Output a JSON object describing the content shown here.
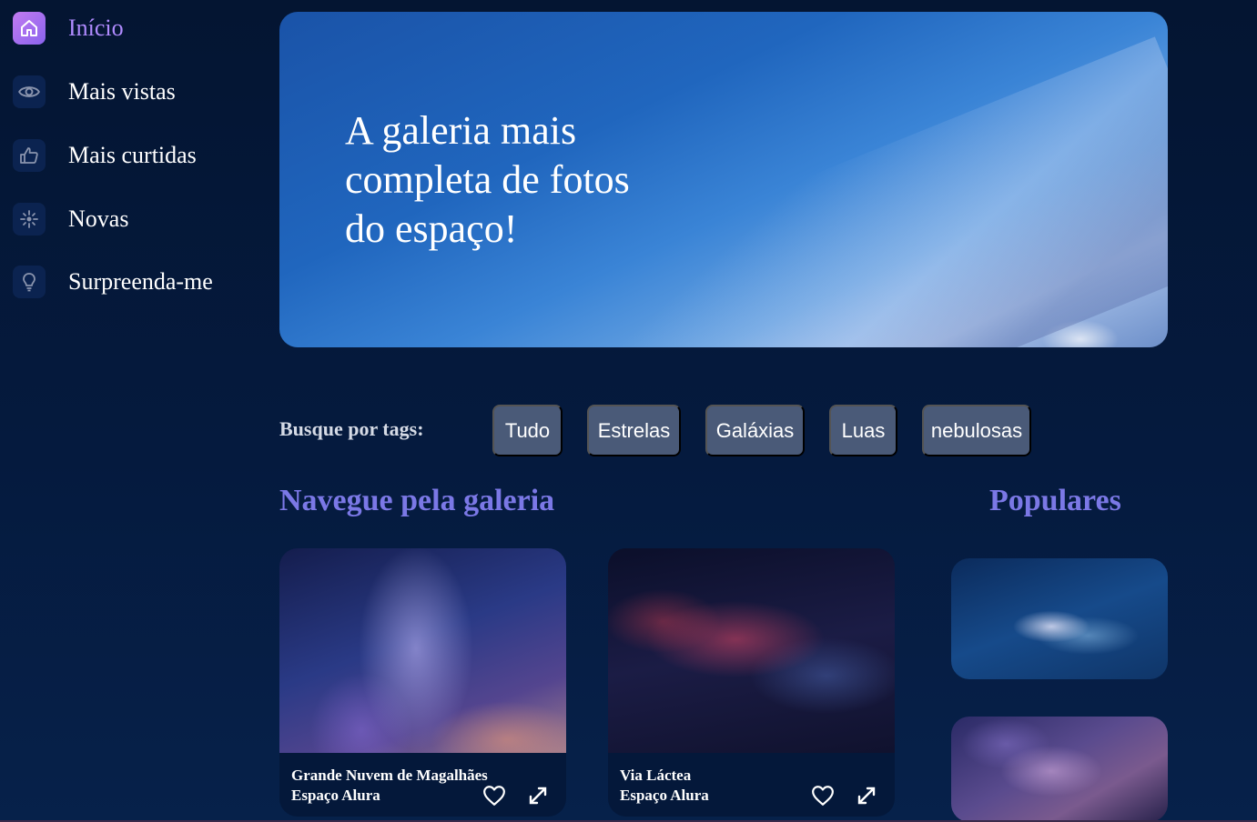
{
  "sidebar": {
    "items": [
      {
        "label": "Início",
        "icon": "home-icon",
        "active": true
      },
      {
        "label": "Mais vistas",
        "icon": "eye-icon"
      },
      {
        "label": "Mais curtidas",
        "icon": "thumbs-up-icon"
      },
      {
        "label": "Novas",
        "icon": "sparkle-icon"
      },
      {
        "label": "Surpreenda-me",
        "icon": "lightbulb-icon"
      }
    ]
  },
  "hero": {
    "title": "A galeria mais completa de fotos do espaço!"
  },
  "tags": {
    "label": "Busque por tags:",
    "items": [
      "Tudo",
      "Estrelas",
      "Galáxias",
      "Luas",
      "nebulosas"
    ]
  },
  "gallery": {
    "title": "Navegue pela galeria",
    "cards": [
      {
        "title": "Grande Nuvem de Magalhães",
        "source": "Espaço Alura"
      },
      {
        "title": "Via Láctea",
        "source": "Espaço Alura"
      }
    ]
  },
  "popular": {
    "title": "Populares"
  },
  "colors": {
    "accent": "#7b78e6",
    "active_nav": "#b08bff",
    "tag_bg": "#4a5a78",
    "background": "#041532"
  }
}
